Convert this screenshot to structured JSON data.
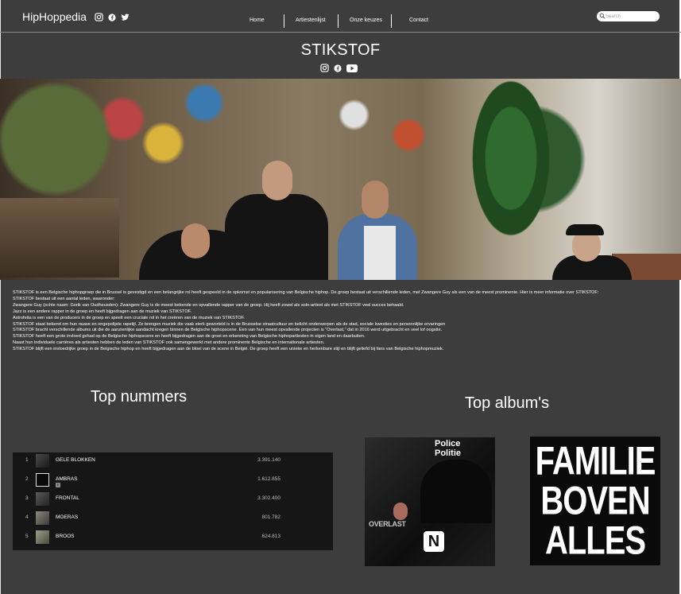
{
  "nav": {
    "brand": "HipHoppedia",
    "menu": [
      "Home",
      "Artiestenlijst",
      "Onze keuzes",
      "Contact"
    ],
    "search_placeholder": "Search"
  },
  "artist": {
    "name": "STIKSTOF"
  },
  "bio": [
    "STIKSTOF is een Belgische hiphopgroep die in Brussel is gevestigd en een belangrijke rol heeft gespeeld in de opkomst en popularisering van Belgische hiphop. De groep bestaat uit verschillende leden, met Zwangere Guy als een van de meest prominente. Hier is meer informatie over STIKSTOF:",
    "STIKSTOF bestaat uit een aantal leden, waaronder:",
    "Zwangere Guy (echte naam: Gorik van Oudheusden): Zwangere Guy is de meest bekende en opvallende rapper van de groep. Hij heeft zowel als solo-artiest als met STIKSTOF veel succes behaald.",
    "Jazz is een andere rapper in de groep en heeft bijgedragen aan de muziek van STIKSTOF.",
    "Astrofeita is een van de producers in de groep en speelt een cruciale rol in het creëren van de muziek van STIKSTOF.",
    "STIKSTOF staat bekend om hun rauwe en ongepolijste rapstijl. Ze brengen muziek die vaak sterk geworteld is in de Brusselse straatcultuur en belicht onderwerpen als de stad, sociale kwesties en persoonlijke ervaringen",
    "STIKSTOF bracht verschillende albums uit die de aanzienlijke aandacht kregen binnen de Belgische hiphopscene. Een van hun meest opvallende projecten is \"Overlast,\" dat in 2016 werd uitgebracht en veel lof oogstte.",
    "STIKSTOF heeft een grote invloed gehad op de Belgische hiphopscene en heeft bijgedragen aan de groei en erkenning van Belgische hiphopartiesten in eigen land en daarbuiten.",
    "Naast hun individuele carrières als artiesten hebben de leden van STIKSTOF ook samengewerkt met andere prominente Belgische en internationale artiesten.",
    "STIKSTOF blijft een invloedrijke groep in de Belgische hiphop en heeft bijgedragen aan de bloei van de scene in België. De groep heeft een unieke en herkenbare stijl en blijft geliefd bij fans van Belgische hiphopmuziek."
  ],
  "sections": {
    "top_tracks": "Top nummers",
    "top_albums": "Top album's"
  },
  "tracks": [
    {
      "num": "1",
      "name": "GELE BLOKKEN",
      "plays": "3.391.140",
      "explicit": false
    },
    {
      "num": "2",
      "name": "AMBRAS",
      "plays": "1.612.855",
      "explicit": true,
      "badge": "E"
    },
    {
      "num": "3",
      "name": "FRONTAL",
      "plays": "3.302.400",
      "explicit": false
    },
    {
      "num": "4",
      "name": "MOERAS",
      "plays": "801.782",
      "explicit": false
    },
    {
      "num": "5",
      "name": "BROOS",
      "plays": "624.813",
      "explicit": false
    }
  ],
  "albums": {
    "overlast": {
      "top_text_1": "Police",
      "top_text_2": "Politie",
      "title": "OVERLAST",
      "logo": "N"
    },
    "familie": {
      "line1": "FAMILIE",
      "line2": "BOVEN",
      "line3": "ALLES"
    }
  },
  "colors": {
    "page_bg": "#3d3d3d",
    "table_bg": "#161616",
    "text": "#ffffff"
  }
}
